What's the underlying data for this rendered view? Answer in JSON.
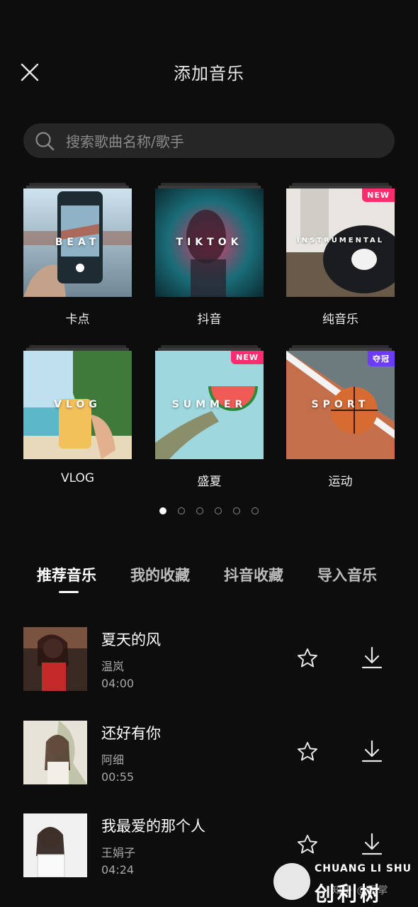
{
  "header": {
    "title": "添加音乐"
  },
  "search": {
    "placeholder": "搜索歌曲名称/歌手"
  },
  "categories": [
    {
      "label": "卡点",
      "cover_text": "BEAT",
      "badge": ""
    },
    {
      "label": "抖音",
      "cover_text": "TIKTOK",
      "badge": ""
    },
    {
      "label": "纯音乐",
      "cover_text": "INSTRUMENTAL",
      "badge": "NEW"
    },
    {
      "label": "VLOG",
      "cover_text": "VLOG",
      "badge": ""
    },
    {
      "label": "盛夏",
      "cover_text": "SUMMER",
      "badge": "NEW"
    },
    {
      "label": "运动",
      "cover_text": "SPORT",
      "badge": "夺冠"
    }
  ],
  "pager": {
    "pages": 6,
    "active": 1
  },
  "tabs": [
    {
      "label": "推荐音乐"
    },
    {
      "label": "我的收藏"
    },
    {
      "label": "抖音收藏"
    },
    {
      "label": "导入音乐"
    }
  ],
  "songs": [
    {
      "name": "夏天的风",
      "artist": "温岚",
      "duration": "04:00"
    },
    {
      "name": "还好有你",
      "artist": "阿细",
      "duration": "00:55"
    },
    {
      "name": "我最爱的那个人",
      "artist": "王娟子",
      "duration": "04:24"
    }
  ],
  "watermark": {
    "top": "CHUANG LI SHU",
    "bottom": "创利树",
    "faint": "知乎 @辰掌"
  },
  "colors": {
    "background": "#0d0d0d",
    "new_badge": "#ff2d6f",
    "champion_badge": "#6b3bf5"
  },
  "icons": {
    "close": "close-icon",
    "search": "search-icon",
    "favorite": "star-outline-icon",
    "download": "download-icon"
  }
}
